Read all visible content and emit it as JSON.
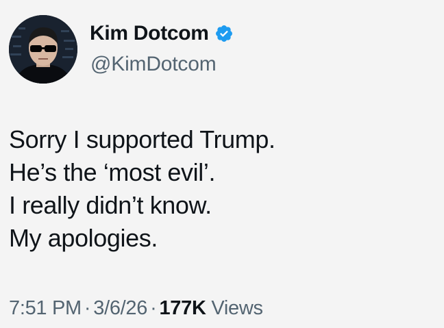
{
  "author": {
    "display_name": "Kim Dotcom",
    "handle": "@KimDotcom",
    "verified_color": "#1d9bf0"
  },
  "post": {
    "lines": [
      "Sorry I supported Trump.",
      "He’s the ‘most evil’.",
      "I really didn’t know.",
      "My apologies."
    ]
  },
  "meta": {
    "time": "7:51 PM",
    "date": "3/6/26",
    "separator": "·",
    "views_count": "177K",
    "views_label": "Views"
  }
}
